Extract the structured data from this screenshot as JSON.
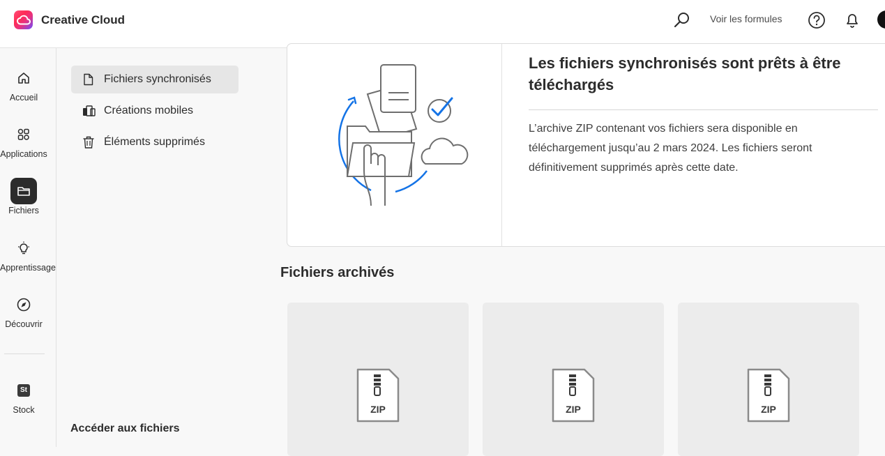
{
  "header": {
    "app_title": "Creative Cloud",
    "plans_link": "Voir les formules"
  },
  "rail": {
    "items": [
      {
        "label": "Accueil",
        "icon": "home-icon"
      },
      {
        "label": "Applications",
        "icon": "apps-icon"
      },
      {
        "label": "Fichiers",
        "icon": "folder-icon",
        "active": true
      },
      {
        "label": "Apprentissage",
        "icon": "lightbulb-icon"
      },
      {
        "label": "Découvrir",
        "icon": "compass-icon"
      },
      {
        "label": "Stock",
        "icon": "stock-icon",
        "badge": "St"
      }
    ]
  },
  "files_nav": {
    "items": [
      {
        "label": "Fichiers synchronisés",
        "icon": "document-icon",
        "selected": true
      },
      {
        "label": "Créations mobiles",
        "icon": "mobile-creations-icon"
      },
      {
        "label": "Éléments supprimés",
        "icon": "trash-icon"
      }
    ],
    "access_label": "Accéder aux fichiers"
  },
  "card": {
    "title": "Les fichiers synchronisés sont prêts à être téléchargés",
    "body": "L’archive ZIP contenant vos fichiers sera disponible en téléchargement jusqu’au 2 mars 2024. Les fichiers seront définitivement supprimés après cette date."
  },
  "archived": {
    "title": "Fichiers archivés",
    "tiles": [
      {
        "file_type": "ZIP"
      },
      {
        "file_type": "ZIP"
      },
      {
        "file_type": "ZIP"
      }
    ]
  },
  "colors": {
    "accent_blue": "#1473e6",
    "active_rail": "#2c2c2c",
    "selected_nav": "#e6e6e6"
  }
}
